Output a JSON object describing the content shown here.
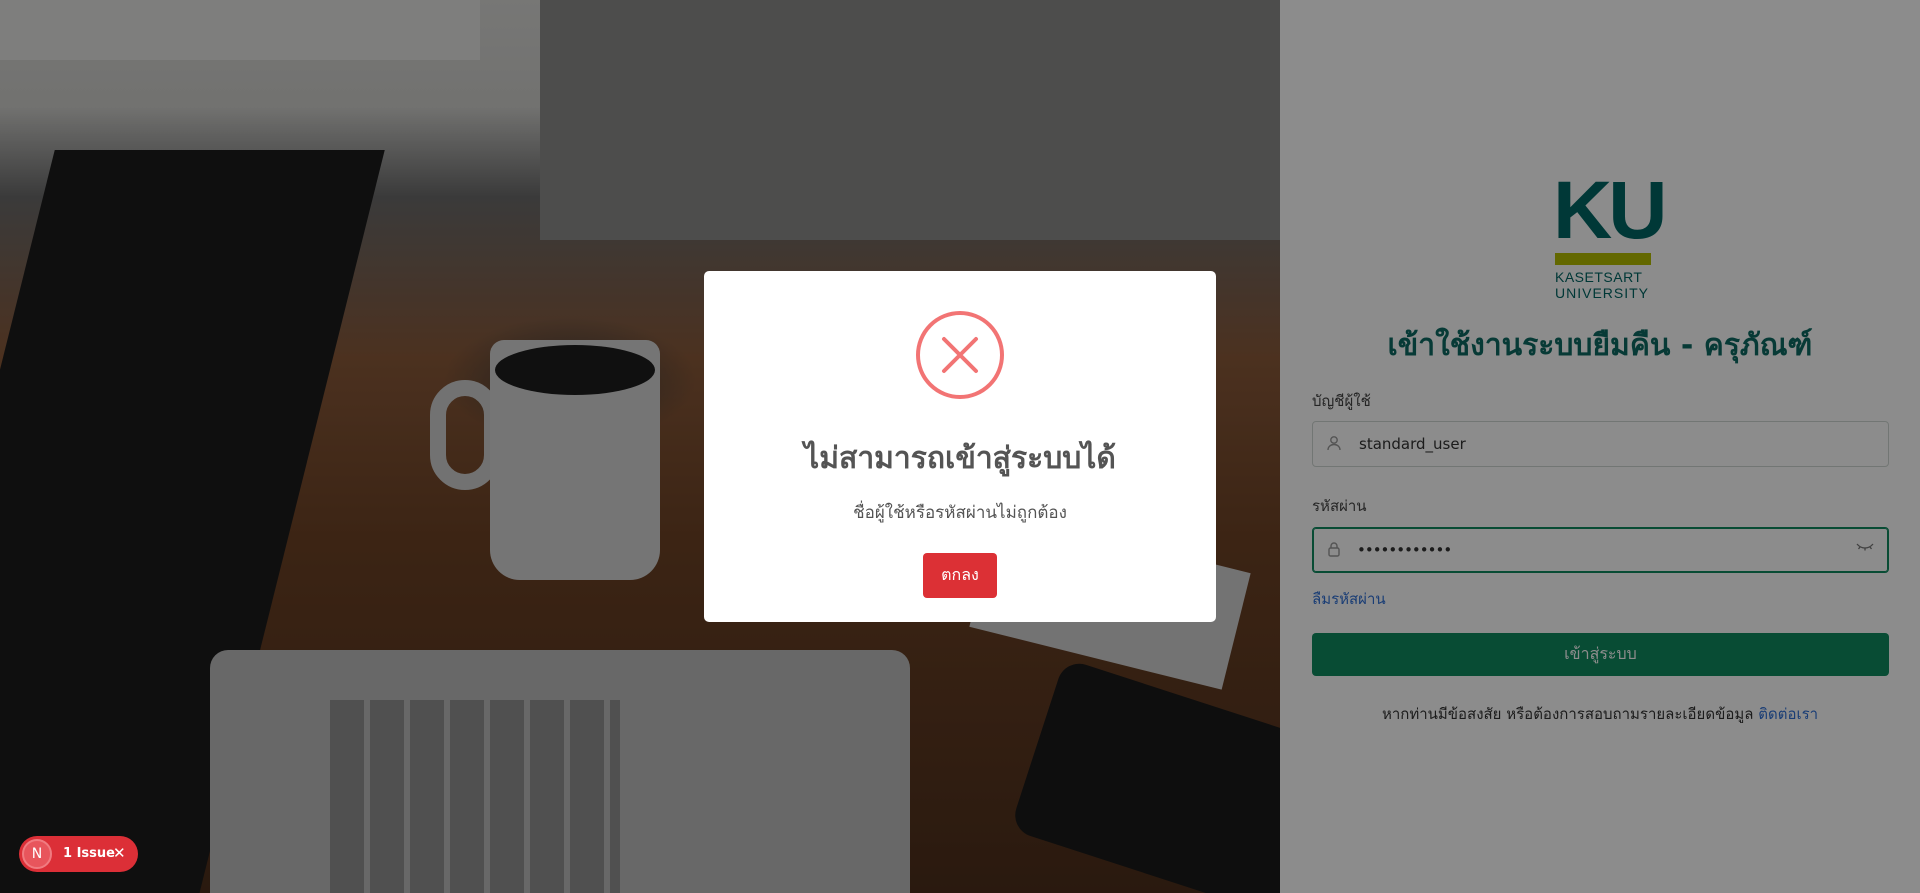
{
  "login": {
    "logo": {
      "mark": "KU",
      "line1": "KASETSART",
      "line2": "UNIVERSITY"
    },
    "title": "เข้าใช้งานระบบยืมคืน - ครุภัณฑ์",
    "username_label": "บัญชีผู้ใช้",
    "username_value": "standard_user",
    "password_label": "รหัสผ่าน",
    "password_value": "••••••••••••",
    "forgot_link": "ลืมรหัสผ่าน",
    "submit_label": "เข้าสู่ระบบ",
    "help_text": "หากท่านมีข้อสงสัย หรือต้องการสอบถามรายละเอียดข้อมูล",
    "contact_link": "ติดต่อเรา"
  },
  "modal": {
    "title": "ไม่สามารถเข้าสู่ระบบได้",
    "message": "ชื่อผู้ใช้หรือรหัสผ่านไม่ถูกต้อง",
    "ok_label": "ตกลง"
  },
  "issue_badge": {
    "avatar_letter": "N",
    "label": "1 Issue"
  },
  "colors": {
    "brand_green": "#0f8a5f",
    "logo_teal": "#006664",
    "logo_lime": "#b5bd00",
    "error_red": "#f27474",
    "ok_button": "#dc3035",
    "link_blue": "#2f6fd6"
  }
}
